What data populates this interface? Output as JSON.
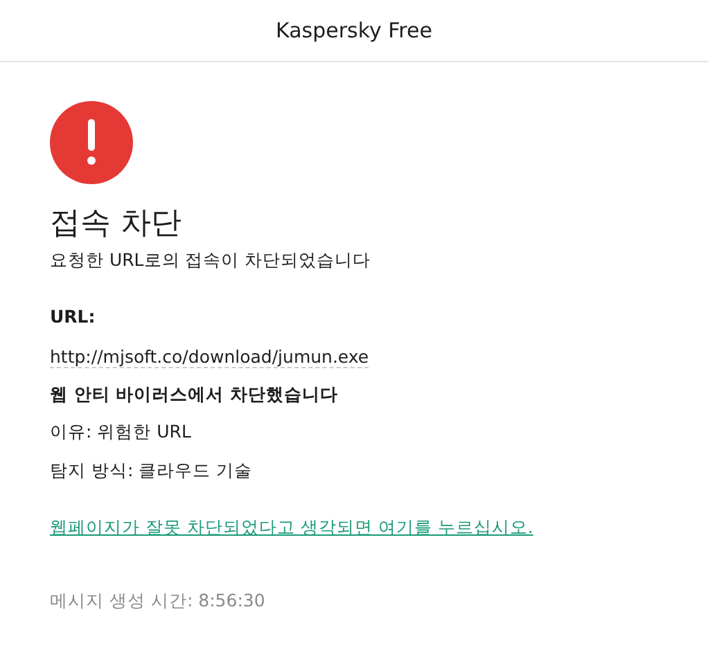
{
  "window": {
    "title": "Kaspersky Free"
  },
  "heading": "접속 차단",
  "subtitle": "요청한 URL로의 접속이 차단되었습니다",
  "url_label": "URL:",
  "url": "http://mjsoft.co/download/jumun.exe",
  "blocked_by": "웹 안티 바이러스에서 차단했습니다",
  "details": [
    "이유: 위험한 URL",
    "탐지 방식: 클라우드 기술"
  ],
  "report_link": "웹페이지가 잘못 차단되었다고 생각되면 여기를 누르십시오.",
  "timestamp": "메시지 생성 시간: 8:56:30"
}
